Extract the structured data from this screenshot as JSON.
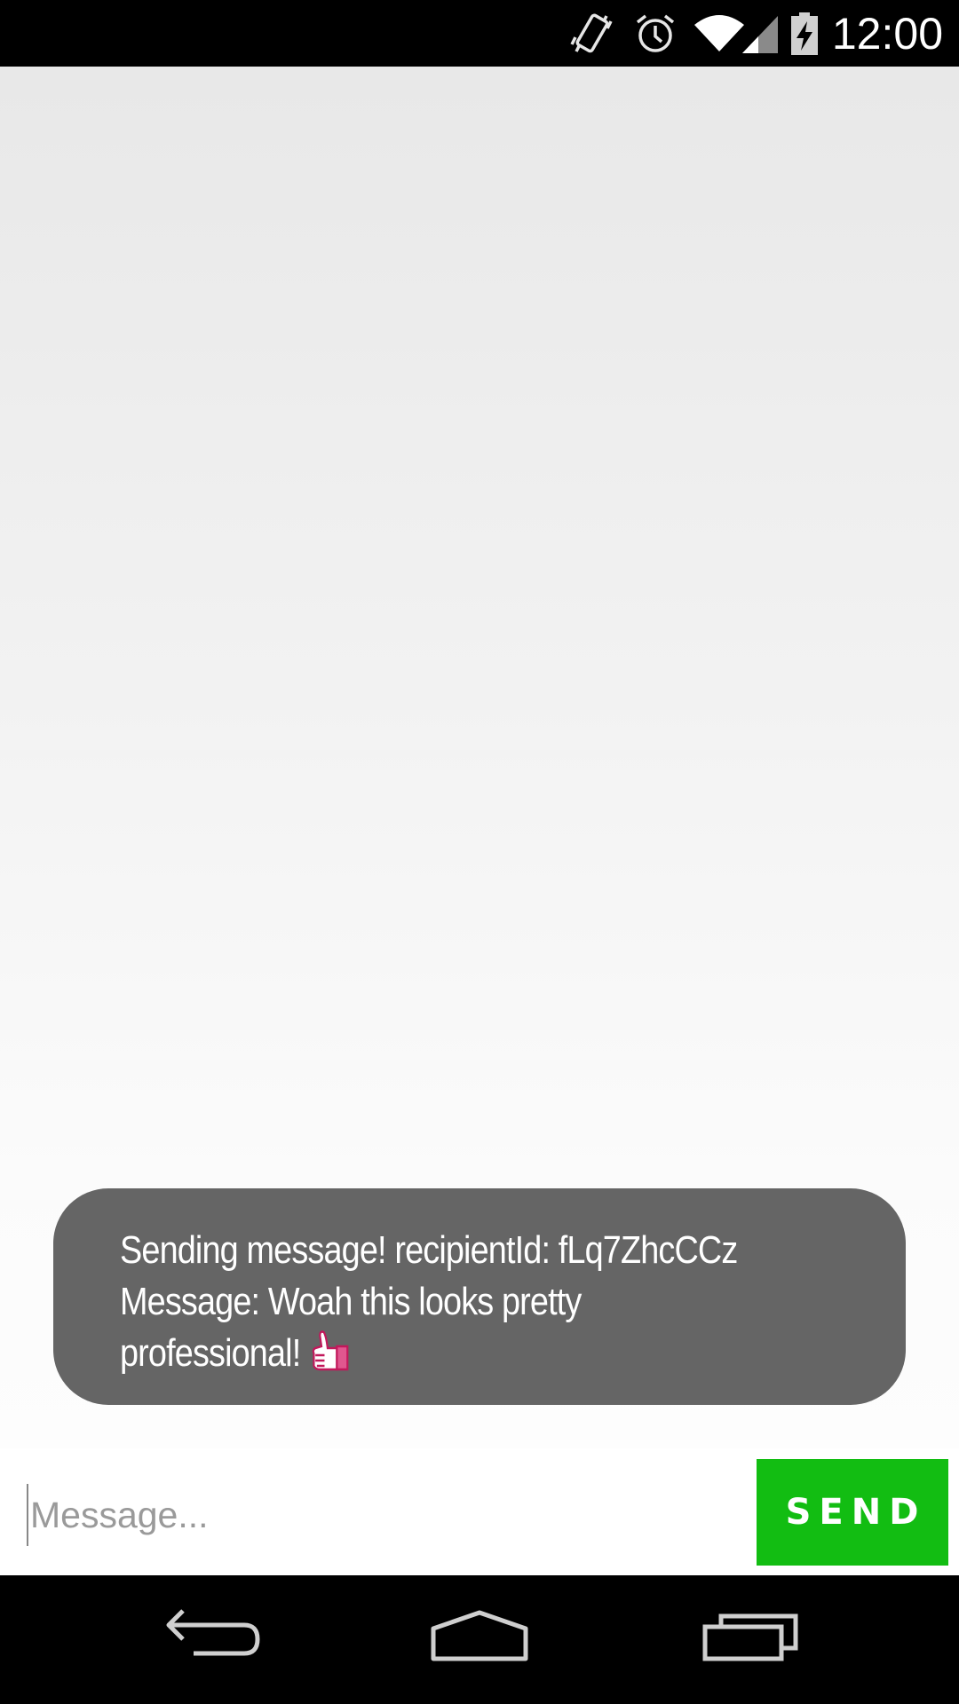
{
  "status_bar": {
    "time": "12:00",
    "icons": [
      "vibrate-icon",
      "alarm-icon",
      "wifi-icon",
      "cell-signal-icon",
      "battery-charging-icon"
    ]
  },
  "toast": {
    "line1": "Sending message! recipientId: fLq7ZhcCCz",
    "line2": "Message: Woah this looks pretty",
    "line3": "professional!",
    "emoji_icon": "thumbs-up-icon"
  },
  "compose": {
    "placeholder": "Message...",
    "value": "",
    "send_label": "SEND"
  },
  "nav_bar": {
    "icons": [
      "back-icon",
      "home-icon",
      "recents-icon"
    ]
  },
  "colors": {
    "send_button": "#12bd12",
    "toast_background": "#656565",
    "bars": "#000000"
  }
}
